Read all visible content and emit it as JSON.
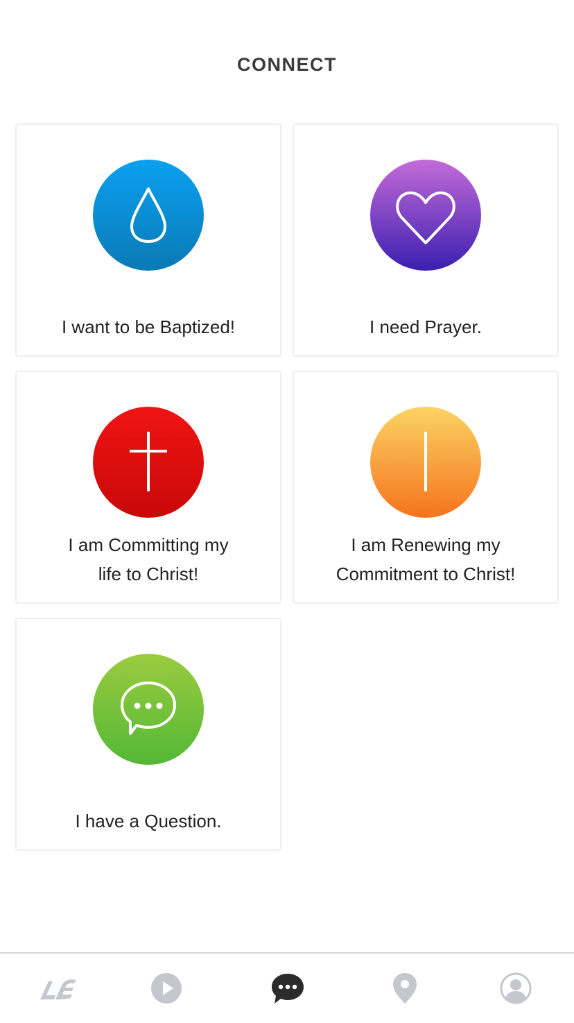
{
  "header": {
    "title": "CONNECT"
  },
  "cards": [
    {
      "label_lines": [
        "I want to be Baptized!"
      ],
      "icon": "water-drop-icon",
      "color_top": "#0aa0f0",
      "color_bottom": "#0a7ab5"
    },
    {
      "label_lines": [
        "I need Prayer."
      ],
      "icon": "heart-icon",
      "color_top": "#c46bd8",
      "color_bottom": "#3a1fb0"
    },
    {
      "label_lines": [
        "I am Committing my",
        "life to Christ!"
      ],
      "icon": "cross-icon",
      "color_top": "#f01414",
      "color_bottom": "#c80808"
    },
    {
      "label_lines": [
        "I am Renewing my",
        "Commitment to Christ!"
      ],
      "icon": "vertical-line-icon",
      "color_top": "#fbd462",
      "color_bottom": "#f6731d"
    },
    {
      "label_lines": [
        "I have a Question."
      ],
      "icon": "chat-bubble-icon",
      "color_top": "#9bcb3f",
      "color_bottom": "#53b835"
    }
  ],
  "tabbar": {
    "items": [
      {
        "icon": "church-logo-icon",
        "active": false
      },
      {
        "icon": "play-icon",
        "active": false
      },
      {
        "icon": "chat-icon",
        "active": true
      },
      {
        "icon": "location-pin-icon",
        "active": false
      },
      {
        "icon": "profile-icon",
        "active": false
      }
    ],
    "active_color": "#2b2b2b",
    "inactive_color": "#c4c7cb"
  }
}
